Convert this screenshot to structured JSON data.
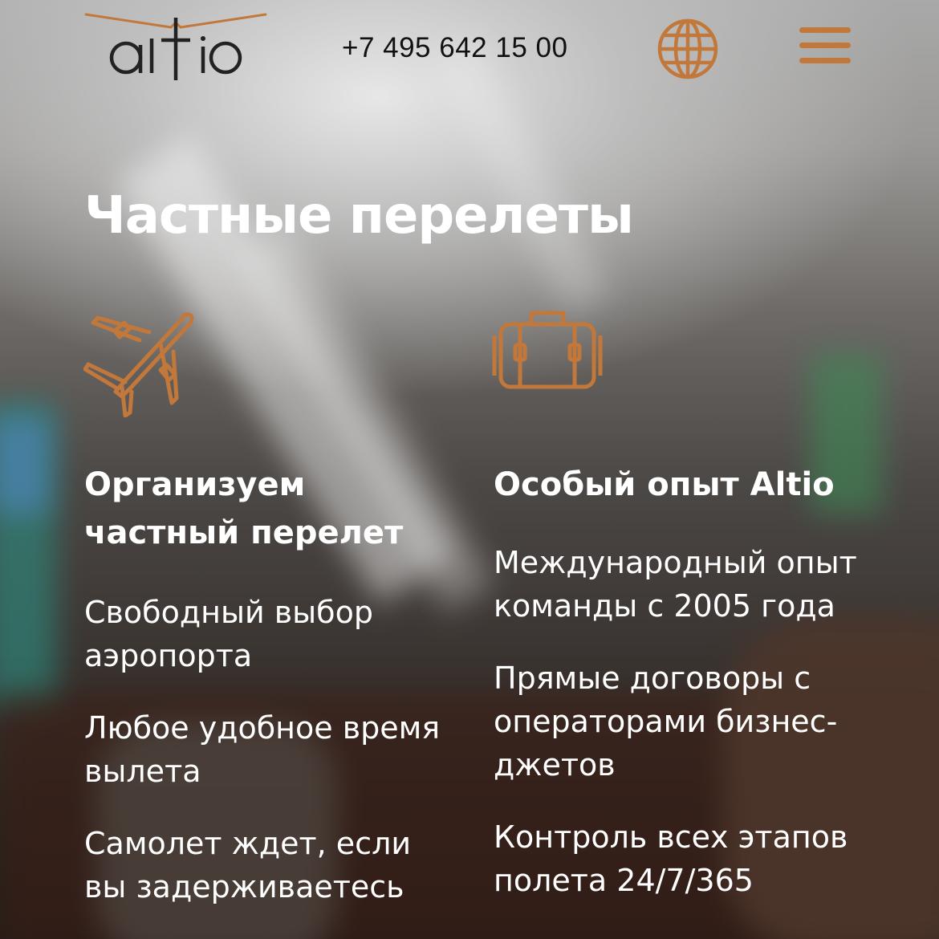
{
  "header": {
    "logo_text": "altio",
    "phone": "+7 495 642 15 00",
    "language_icon": "globe-icon",
    "menu_icon": "hamburger-menu-icon"
  },
  "hero": {
    "title": "Частные перелеты"
  },
  "features": [
    {
      "icon": "airplane-icon",
      "heading": "Организуем частный перелет",
      "items": [
        "Свободный выбор аэропорта",
        "Любое удобное время вылета",
        "Самолет ждет, если вы задерживаетесь"
      ]
    },
    {
      "icon": "suitcase-icon",
      "heading": "Особый опыт Altio",
      "items": [
        "Международный опыт команды с 2005 года",
        "Прямые договоры с операторами бизнес-джетов",
        "Контроль всех этапов полета 24/7/365"
      ]
    }
  ],
  "colors": {
    "accent": "#c2783a",
    "text_light": "#ffffff",
    "text_dark": "#111111"
  }
}
